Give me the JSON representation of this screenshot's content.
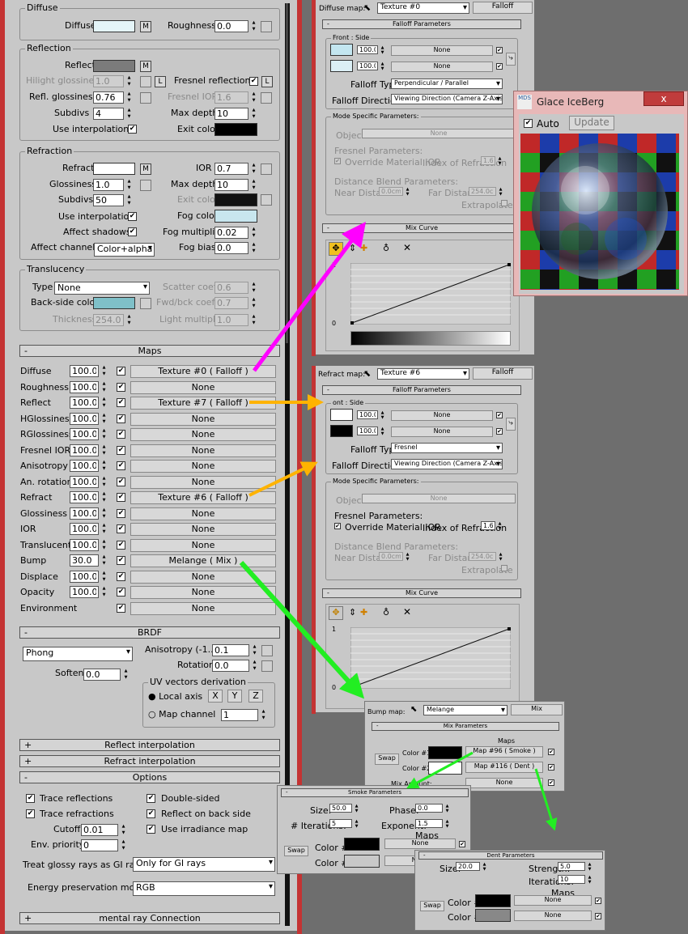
{
  "left": {
    "diffuse": {
      "title": "Diffuse",
      "diffuse_label": "Diffuse",
      "m": "M",
      "roughness_label": "Roughness",
      "roughness": "0.0"
    },
    "reflection": {
      "title": "Reflection",
      "reflect_label": "Reflect",
      "m": "M",
      "hilight_label": "Hilight glossiness",
      "hilight": "1.0",
      "l": "L",
      "fresnel_label": "Fresnel reflections",
      "refl_gloss_label": "Refl. glossiness",
      "refl_gloss": "0.76",
      "fresnel_ior_label": "Fresnel IOR",
      "fresnel_ior": "1.6",
      "subdivs_label": "Subdivs",
      "subdivs": "4",
      "maxdepth_label": "Max depth",
      "maxdepth": "10",
      "useinterp_label": "Use interpolation",
      "exitcolor_label": "Exit color"
    },
    "refraction": {
      "title": "Refraction",
      "refract_label": "Refract",
      "m": "M",
      "ior_label": "IOR",
      "ior": "0.7",
      "gloss_label": "Glossiness",
      "gloss": "1.0",
      "maxdepth_label": "Max depth",
      "maxdepth": "10",
      "subdivs_label": "Subdivs",
      "subdivs": "50",
      "exitcolor_label": "Exit color",
      "useinterp_label": "Use interpolation",
      "fogcolor_label": "Fog color",
      "affectshadows_label": "Affect shadows",
      "fogmult_label": "Fog multiplier",
      "fogmult": "0.02",
      "affectchannels_label": "Affect channels",
      "affectchannels": "Color+alpha",
      "fogbias_label": "Fog bias",
      "fogbias": "0.0"
    },
    "translucency": {
      "title": "Translucency",
      "type_label": "Type",
      "type": "None",
      "scatter_label": "Scatter coeff",
      "scatter": "0.6",
      "backside_label": "Back-side color",
      "fwdbck_label": "Fwd/bck coeff",
      "fwdbck": "0.7",
      "thickness_label": "Thickness",
      "thickness": "254.0c",
      "lightmult_label": "Light multiplier",
      "lightmult": "1.0"
    },
    "maps": {
      "title": "Maps",
      "pm": "-",
      "rows": [
        {
          "name": "Diffuse",
          "amount": "100.0",
          "map": "Texture #0  ( Falloff )"
        },
        {
          "name": "Roughness",
          "amount": "100.0",
          "map": "None"
        },
        {
          "name": "Reflect",
          "amount": "100.0",
          "map": "Texture #7  ( Falloff )"
        },
        {
          "name": "HGlossiness",
          "amount": "100.0",
          "map": "None"
        },
        {
          "name": "RGlossiness",
          "amount": "100.0",
          "map": "None"
        },
        {
          "name": "Fresnel IOR",
          "amount": "100.0",
          "map": "None"
        },
        {
          "name": "Anisotropy",
          "amount": "100.0",
          "map": "None"
        },
        {
          "name": "An. rotation",
          "amount": "100.0",
          "map": "None"
        },
        {
          "name": "Refract",
          "amount": "100.0",
          "map": "Texture #6  ( Falloff )"
        },
        {
          "name": "Glossiness",
          "amount": "100.0",
          "map": "None"
        },
        {
          "name": "IOR",
          "amount": "100.0",
          "map": "None"
        },
        {
          "name": "Translucent",
          "amount": "100.0",
          "map": "None"
        },
        {
          "name": "Bump",
          "amount": "30.0",
          "map": "Melange  ( Mix )"
        },
        {
          "name": "Displace",
          "amount": "100.0",
          "map": "None"
        },
        {
          "name": "Opacity",
          "amount": "100.0",
          "map": "None"
        },
        {
          "name": "Environment",
          "amount": "",
          "map": "None"
        }
      ]
    },
    "brdf": {
      "title": "BRDF",
      "pm": "-",
      "type": "Phong",
      "aniso_label": "Anisotropy (-1..1)",
      "aniso": "0.1",
      "rotation_label": "Rotation",
      "rotation": "0.0",
      "soften_label": "Soften",
      "soften": "0.0",
      "uv_title": "UV vectors derivation",
      "local_label": "Local axis",
      "x": "X",
      "y": "Y",
      "z": "Z",
      "mapch_label": "Map channel",
      "mapch": "1"
    },
    "reflect_interp": {
      "title": "Reflect interpolation",
      "pm": "+"
    },
    "refract_interp": {
      "title": "Refract interpolation",
      "pm": "+"
    },
    "options": {
      "title": "Options",
      "pm": "-",
      "trace_refl": "Trace reflections",
      "trace_refr": "Trace refractions",
      "double_sided": "Double-sided",
      "refl_back": "Reflect on back side",
      "cutoff_label": "Cutoff",
      "cutoff": "0.01",
      "irradiance": "Use irradiance map",
      "envprio_label": "Env. priority",
      "envprio": "0",
      "glossy_label": "Treat glossy rays as GI rays:",
      "glossy": "Only for GI rays",
      "energy_label": "Energy preservation mode:",
      "energy": "RGB"
    },
    "mentalray": {
      "title": "mental ray Connection",
      "pm": "+"
    }
  },
  "diffuse_panel": {
    "map_label": "Diffuse map:",
    "map_name": "Texture #0",
    "type_btn": "Falloff",
    "params_title": "Falloff Parameters",
    "front_side": "Front : Side",
    "v1": "100.0",
    "v2": "100.0",
    "none": "None",
    "falloff_type_label": "Falloff Type:",
    "falloff_type": "Perpendicular / Parallel",
    "falloff_dir_label": "Falloff Direction:",
    "falloff_dir": "Viewing Direction (Camera Z-Axis)",
    "mode_title": "Mode Specific Parameters:",
    "object_label": "Object:",
    "fresnel_title": "Fresnel Parameters:",
    "override": "Override Material IOR",
    "ior_label": "Index of Refraction",
    "ior": "1.6",
    "dist_title": "Distance Blend Parameters:",
    "near_label": "Near Distance:",
    "near": "0.0cm",
    "far_label": "Far Distance:",
    "far": "254.0cm",
    "extrapolate": "Extrapolate",
    "mix_title": "Mix Curve",
    "y1": "1",
    "y0": "0"
  },
  "refract_panel": {
    "map_label": "Refract map:",
    "map_name": "Texture #6",
    "type_btn": "Falloff",
    "params_title": "Falloff Parameters",
    "front_side": "ont : Side",
    "v1": "100.0",
    "v2": "100.0",
    "none": "None",
    "falloff_type_label": "Falloff Type:",
    "falloff_type": "Fresnel",
    "falloff_dir_label": "Falloff Direction:",
    "falloff_dir": "Viewing Direction (Camera Z-Axis)",
    "mode_title": "Mode Specific Parameters:",
    "object_label": "Object:",
    "fresnel_title": "Fresnel Parameters:",
    "override": "Override Material IOR",
    "ior_label": "Index of Refraction",
    "ior": "1.6",
    "dist_title": "Distance Blend Parameters:",
    "near_label": "Near Distance:",
    "near": "0.0cm",
    "far_label": "Far Distance:",
    "far": "254.0cm",
    "extrapolate": "Extrapolate",
    "mix_title": "Mix Curve",
    "y1": "1",
    "y0": "0"
  },
  "preview": {
    "title": "Glace IceBerg",
    "close": "x",
    "auto": "Auto",
    "update": "Update",
    "logo": "MDS"
  },
  "bump": {
    "map_label": "Bump map:",
    "name": "Melange",
    "type_btn": "Mix",
    "params_title": "Mix Parameters",
    "maps_label": "Maps",
    "swap": "Swap",
    "c1": "Color #1",
    "c2": "Color #2",
    "map1": "Map #96  ( Smoke )",
    "map2": "Map #116  ( Dent )",
    "mix_label": "Mix Amount:",
    "none": "None"
  },
  "smoke": {
    "title": "Smoke Parameters",
    "size_label": "Size:",
    "size": "50.0",
    "phase_label": "Phase:",
    "phase": "0.0",
    "iter_label": "# Iterations:",
    "iter": "5",
    "exp_label": "Exponent:",
    "exp": "1.5",
    "maps_label": "Maps",
    "swap": "Swap",
    "c1": "Color #1",
    "c2": "Color #2",
    "none": "None"
  },
  "dent": {
    "title": "Dent Parameters",
    "size_label": "Size:",
    "size": "20.0",
    "strength_label": "Strength:",
    "strength": "5.0",
    "iter_label": "Iterations:",
    "iter": "10",
    "maps_label": "Maps",
    "swap": "Swap",
    "c1": "Color #1",
    "c2": "Color #2",
    "none": "None"
  },
  "colors": {
    "magenta": "#ff00ff",
    "orange": "#ffb300",
    "green": "#22ee22"
  }
}
